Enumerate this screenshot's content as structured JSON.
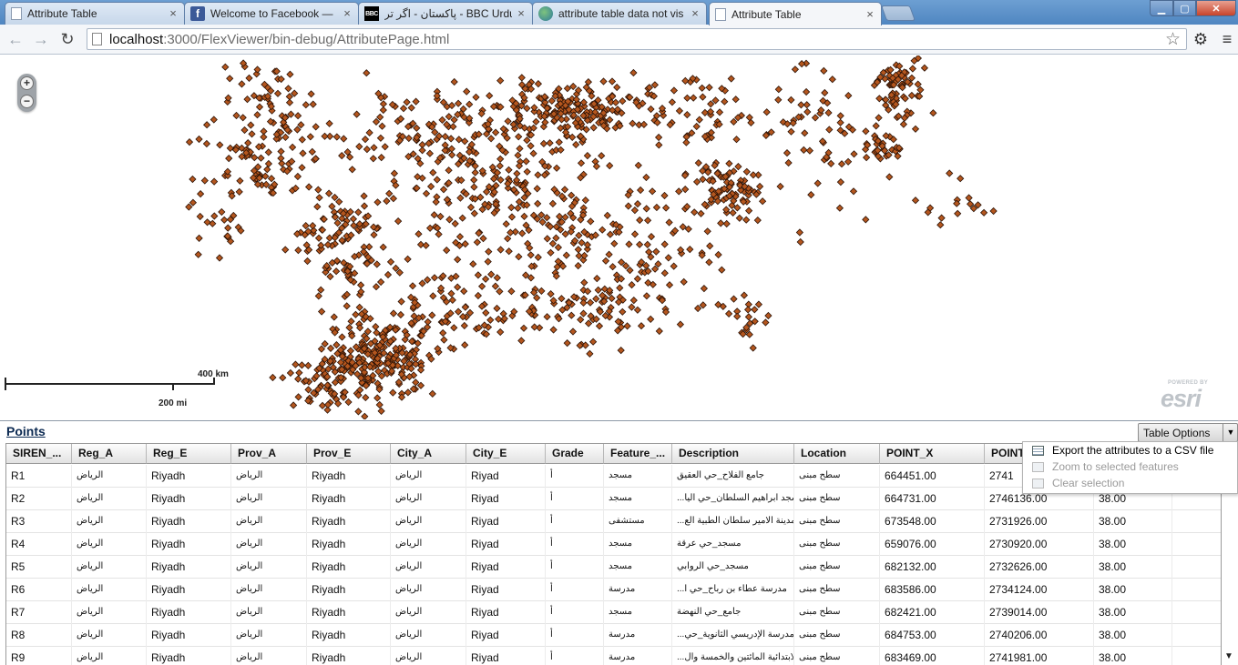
{
  "browser": {
    "tabs": [
      {
        "title": "Attribute Table",
        "icon": "document-icon",
        "active": false
      },
      {
        "title": "Welcome to Facebook —",
        "icon": "facebook-icon",
        "active": false
      },
      {
        "title": "پاکستان - اگر تر - BBC Urdu",
        "icon": "bbc-icon",
        "active": false
      },
      {
        "title": "attribute table data not vis",
        "icon": "globe-icon",
        "active": false
      },
      {
        "title": "Attribute Table",
        "icon": "document-icon",
        "active": true
      }
    ],
    "url_host": "localhost",
    "url_rest": ":3000/FlexViewer/bin-debug/AttributePage.html",
    "bbc_favicon_text": "BBC"
  },
  "map": {
    "zoom_in": "+",
    "zoom_out": "−",
    "scale_km": "400 km",
    "scale_mi": "200 mi",
    "esri_powered": "POWERED BY",
    "esri_logo": "esri",
    "point_color": "#b4561e",
    "point_stroke": "#2a1206"
  },
  "table": {
    "layer_title": "Points",
    "options_label": "Table Options",
    "options_menu": [
      {
        "label": "Export the attributes to a CSV file",
        "enabled": true
      },
      {
        "label": "Zoom to selected features",
        "enabled": false
      },
      {
        "label": "Clear selection",
        "enabled": false
      }
    ],
    "columns": [
      "SIREN_...",
      "Reg_A",
      "Reg_E",
      "Prov_A",
      "Prov_E",
      "City_A",
      "City_E",
      "Grade",
      "Feature_...",
      "Description",
      "Location",
      "POINT_X",
      "POINT_",
      "",
      ""
    ],
    "rows": [
      [
        "R1",
        "الرياض",
        "Riyadh",
        "الرياض",
        "Riyadh",
        "الرياض",
        "Riyad",
        "أ",
        "مسجد",
        "جامع الفلاح_حي العقيق",
        "سطح مبنى",
        "664451.00",
        "2741",
        "",
        ""
      ],
      [
        "R2",
        "الرياض",
        "Riyadh",
        "الرياض",
        "Riyadh",
        "الرياض",
        "Riyad",
        "أ",
        "مسجد",
        "...مسجد ابراهيم السلطان_حي اليا",
        "سطح مبنى",
        "664731.00",
        "2746136.00",
        "38.00",
        ""
      ],
      [
        "R3",
        "الرياض",
        "Riyadh",
        "الرياض",
        "Riyadh",
        "الرياض",
        "Riyad",
        "أ",
        "مستشفى",
        "...مدينة الامير سلطان الطبية الع",
        "سطح مبنى",
        "673548.00",
        "2731926.00",
        "38.00",
        ""
      ],
      [
        "R4",
        "الرياض",
        "Riyadh",
        "الرياض",
        "Riyadh",
        "الرياض",
        "Riyad",
        "أ",
        "مسجد",
        "مسجد_حي عرقة",
        "سطح مبنى",
        "659076.00",
        "2730920.00",
        "38.00",
        ""
      ],
      [
        "R5",
        "الرياض",
        "Riyadh",
        "الرياض",
        "Riyadh",
        "الرياض",
        "Riyad",
        "أ",
        "مسجد",
        "مسجد_حي الروابي",
        "سطح مبنى",
        "682132.00",
        "2732626.00",
        "38.00",
        ""
      ],
      [
        "R6",
        "الرياض",
        "Riyadh",
        "الرياض",
        "Riyadh",
        "الرياض",
        "Riyad",
        "أ",
        "مدرسة",
        "...مدرسة عطاء بن رباح_حي ا",
        "سطح مبنى",
        "683586.00",
        "2734124.00",
        "38.00",
        ""
      ],
      [
        "R7",
        "الرياض",
        "Riyadh",
        "الرياض",
        "Riyadh",
        "الرياض",
        "Riyad",
        "أ",
        "مسجد",
        "جامع_حي النهضة",
        "سطح مبنى",
        "682421.00",
        "2739014.00",
        "38.00",
        ""
      ],
      [
        "R8",
        "الرياض",
        "Riyadh",
        "الرياض",
        "Riyadh",
        "الرياض",
        "Riyad",
        "أ",
        "مدرسة",
        "...مدرسة الإدريسي الثانوية_حي",
        "سطح مبنى",
        "684753.00",
        "2740206.00",
        "38.00",
        ""
      ],
      [
        "R9",
        "الرياض",
        "Riyadh",
        "الرياض",
        "Riyadh",
        "الرياض",
        "Riyad",
        "أ",
        "مدرسة",
        "...الابتدائية المائتين والخمسة وال",
        "سطح مبنى",
        "683469.00",
        "2741981.00",
        "38.00",
        ""
      ]
    ],
    "scroll_down": "▼"
  }
}
